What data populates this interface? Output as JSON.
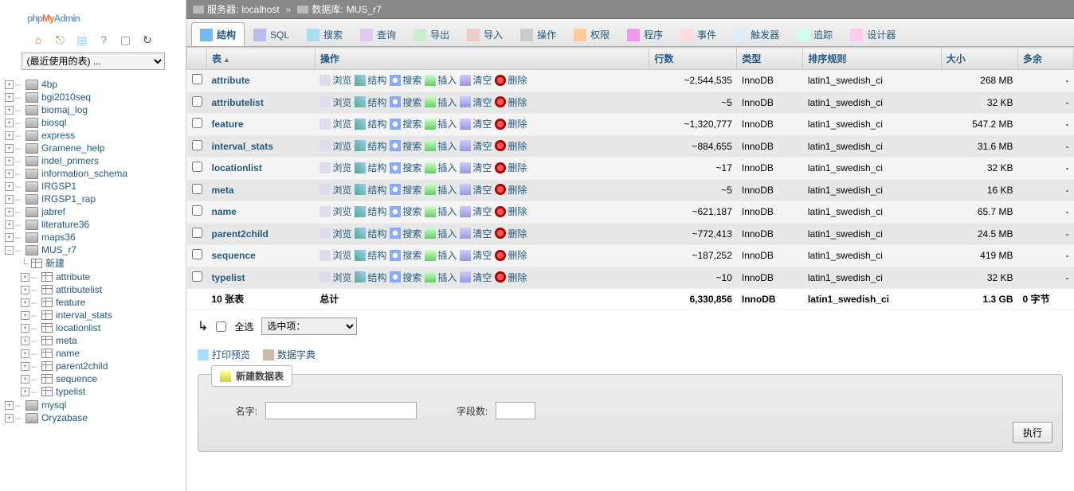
{
  "logo": {
    "p1": "php",
    "p2": "My",
    "p3": "Admin"
  },
  "recent_placeholder": "(最近使用的表) ...",
  "toolbar": {
    "home": "⌂",
    "exit": "⎋",
    "sql": "▤",
    "help": "?",
    "doc": "▢",
    "reload": "↻"
  },
  "breadcrumb": {
    "server_label": "服务器:",
    "server": "localhost",
    "sep": "»",
    "db_label": "数据库:",
    "db": "MUS_r7"
  },
  "databases": [
    {
      "name": "4bp"
    },
    {
      "name": "bgi2010seq"
    },
    {
      "name": "biomaj_log"
    },
    {
      "name": "biosql"
    },
    {
      "name": "express"
    },
    {
      "name": "Gramene_help"
    },
    {
      "name": "indel_primers"
    },
    {
      "name": "information_schema"
    },
    {
      "name": "IRGSP1"
    },
    {
      "name": "IRGSP1_rap"
    },
    {
      "name": "jabref"
    },
    {
      "name": "literature36"
    },
    {
      "name": "maps36"
    }
  ],
  "current_db": {
    "name": "MUS_r7",
    "new_label": "新建",
    "tables": [
      "attribute",
      "attributelist",
      "feature",
      "interval_stats",
      "locationlist",
      "meta",
      "name",
      "parent2child",
      "sequence",
      "typelist"
    ]
  },
  "databases_after": [
    {
      "name": "mysql"
    },
    {
      "name": "Oryzabase"
    }
  ],
  "tabs": [
    {
      "key": "structure",
      "label": "结构",
      "active": true
    },
    {
      "key": "sql",
      "label": "SQL"
    },
    {
      "key": "search",
      "label": "搜索"
    },
    {
      "key": "query",
      "label": "查询"
    },
    {
      "key": "export",
      "label": "导出"
    },
    {
      "key": "import",
      "label": "导入"
    },
    {
      "key": "operations",
      "label": "操作"
    },
    {
      "key": "privileges",
      "label": "权限"
    },
    {
      "key": "routines",
      "label": "程序"
    },
    {
      "key": "events",
      "label": "事件"
    },
    {
      "key": "triggers",
      "label": "触发器"
    },
    {
      "key": "tracking",
      "label": "追踪"
    },
    {
      "key": "designer",
      "label": "设计器"
    }
  ],
  "table_headers": {
    "table": "表",
    "ops": "操作",
    "rows": "行数",
    "type": "类型",
    "collation": "排序规则",
    "size": "大小",
    "overhead": "多余"
  },
  "row_actions": {
    "browse": "浏览",
    "structure": "结构",
    "search": "搜索",
    "insert": "插入",
    "empty": "清空",
    "drop": "删除"
  },
  "rows": [
    {
      "name": "attribute",
      "rows": "~2,544,535",
      "type": "InnoDB",
      "coll": "latin1_swedish_ci",
      "size": "268 MB",
      "ov": "-"
    },
    {
      "name": "attributelist",
      "rows": "~5",
      "type": "InnoDB",
      "coll": "latin1_swedish_ci",
      "size": "32 KB",
      "ov": "-"
    },
    {
      "name": "feature",
      "rows": "~1,320,777",
      "type": "InnoDB",
      "coll": "latin1_swedish_ci",
      "size": "547.2 MB",
      "ov": "-"
    },
    {
      "name": "interval_stats",
      "rows": "~884,655",
      "type": "InnoDB",
      "coll": "latin1_swedish_ci",
      "size": "31.6 MB",
      "ov": "-"
    },
    {
      "name": "locationlist",
      "rows": "~17",
      "type": "InnoDB",
      "coll": "latin1_swedish_ci",
      "size": "32 KB",
      "ov": "-"
    },
    {
      "name": "meta",
      "rows": "~5",
      "type": "InnoDB",
      "coll": "latin1_swedish_ci",
      "size": "16 KB",
      "ov": "-"
    },
    {
      "name": "name",
      "rows": "~621,187",
      "type": "InnoDB",
      "coll": "latin1_swedish_ci",
      "size": "65.7 MB",
      "ov": "-"
    },
    {
      "name": "parent2child",
      "rows": "~772,413",
      "type": "InnoDB",
      "coll": "latin1_swedish_ci",
      "size": "24.5 MB",
      "ov": "-"
    },
    {
      "name": "sequence",
      "rows": "~187,252",
      "type": "InnoDB",
      "coll": "latin1_swedish_ci",
      "size": "419 MB",
      "ov": "-"
    },
    {
      "name": "typelist",
      "rows": "~10",
      "type": "InnoDB",
      "coll": "latin1_swedish_ci",
      "size": "32 KB",
      "ov": "-"
    }
  ],
  "totals": {
    "label": "10 张表",
    "sum": "总计",
    "rows": "6,330,856",
    "type": "InnoDB",
    "coll": "latin1_swedish_ci",
    "size": "1.3 GB",
    "ov": "0 字节"
  },
  "checkall": {
    "label": "全选",
    "with_selected": "选中项："
  },
  "extras": {
    "print": "打印预览",
    "dict": "数据字典"
  },
  "newtable": {
    "legend": "新建数据表",
    "name_label": "名字:",
    "cols_label": "字段数:",
    "submit": "执行"
  }
}
